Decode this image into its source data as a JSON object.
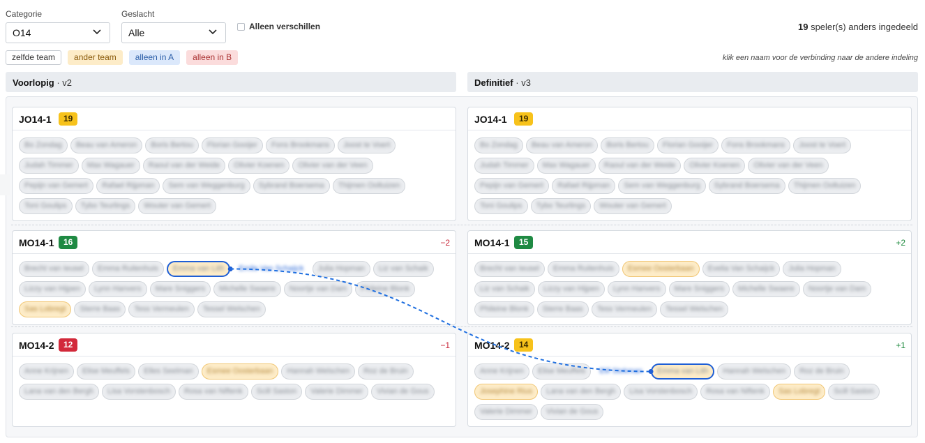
{
  "filters": {
    "category": {
      "label": "Categorie",
      "value": "O14"
    },
    "gender": {
      "label": "Geslacht",
      "value": "Alle"
    },
    "only_diff": {
      "label": "Alleen verschillen"
    }
  },
  "summary": {
    "count": "19",
    "text": "speler(s) anders ingedeeld"
  },
  "legend": {
    "same": "zelfde team",
    "other": "ander team",
    "only_a": "alleen in A",
    "only_b": "alleen in B"
  },
  "hint": "klik een naam voor de verbinding naar de andere indeling",
  "columns": {
    "left": {
      "name": "Voorlopig",
      "version": "· v2"
    },
    "right": {
      "name": "Definitief",
      "version": "· v3"
    }
  },
  "colors": {
    "accent": "#1f5fd6",
    "changed": "#fdecc8",
    "only_a": "#dbe8fb",
    "only_b": "#fbdcdc"
  },
  "left_teams": [
    {
      "name": "JO14-1",
      "count": "19",
      "badge": "yellow",
      "delta": "",
      "players": [
        {
          "n": "Bo Zondag",
          "s": ""
        },
        {
          "n": "Beau van Ameron",
          "s": ""
        },
        {
          "n": "Boris Bertou",
          "s": ""
        },
        {
          "n": "Florian Gooijer",
          "s": ""
        },
        {
          "n": "Fons Brookmans",
          "s": ""
        },
        {
          "n": "Joost te Voert",
          "s": ""
        },
        {
          "n": "Judah Timmer",
          "s": ""
        },
        {
          "n": "Max Wagauer",
          "s": ""
        },
        {
          "n": "Raoul van der Weide",
          "s": ""
        },
        {
          "n": "Olivier Koenen",
          "s": ""
        },
        {
          "n": "Olivier van der Veen",
          "s": ""
        },
        {
          "n": "Pepijn van Gemert",
          "s": ""
        },
        {
          "n": "Rafael Rijpman",
          "s": ""
        },
        {
          "n": "Sem van Weggenburg",
          "s": ""
        },
        {
          "n": "Sybrand Boersema",
          "s": ""
        },
        {
          "n": "Thijmen Ooltuizen",
          "s": ""
        },
        {
          "n": "Toni Goulips",
          "s": ""
        },
        {
          "n": "Tybo Teurlings",
          "s": ""
        },
        {
          "n": "Wouter van Gemert",
          "s": ""
        }
      ]
    },
    {
      "name": "MO14-1",
      "count": "16",
      "badge": "green",
      "delta": "−2",
      "players": [
        {
          "n": "Brecht van Ieusel",
          "s": ""
        },
        {
          "n": "Emma Ruitenhuis",
          "s": ""
        },
        {
          "n": "Emma van Lith",
          "s": "sel"
        },
        {
          "n": "Emile Van Schaijck",
          "s": "blue"
        },
        {
          "n": "Julia Hopman",
          "s": ""
        },
        {
          "n": "Liz van Schaik",
          "s": ""
        },
        {
          "n": "Lizzy van Hijpen",
          "s": ""
        },
        {
          "n": "Lynn Hanvers",
          "s": ""
        },
        {
          "n": "Mare Sniggers",
          "s": ""
        },
        {
          "n": "Michelle Swaere",
          "s": ""
        },
        {
          "n": "Noortje van Dam",
          "s": ""
        },
        {
          "n": "Phileine Blonk",
          "s": ""
        },
        {
          "n": "Sas Lobregt",
          "s": "orange"
        },
        {
          "n": "Sterre Baas",
          "s": ""
        },
        {
          "n": "Tess Vermeulen",
          "s": ""
        },
        {
          "n": "Tessel Welschen",
          "s": ""
        }
      ]
    },
    {
      "name": "MO14-2",
      "count": "12",
      "badge": "red",
      "delta": "−1",
      "players": [
        {
          "n": "Anne Krijnen",
          "s": ""
        },
        {
          "n": "Elise Meuffels",
          "s": ""
        },
        {
          "n": "Elles Seelman",
          "s": ""
        },
        {
          "n": "Esmee Oosterbaan",
          "s": "orange"
        },
        {
          "n": "Hannah Welschen",
          "s": ""
        },
        {
          "n": "Roz de Bruin",
          "s": ""
        },
        {
          "n": "Lana van den Bergh",
          "s": ""
        },
        {
          "n": "Lisa Vorstenbosch",
          "s": ""
        },
        {
          "n": "Rosa van Niftenk",
          "s": ""
        },
        {
          "n": "Scill Saston",
          "s": ""
        },
        {
          "n": "Valerie Dimmer",
          "s": ""
        },
        {
          "n": "Vivian de Gous",
          "s": ""
        }
      ]
    }
  ],
  "right_teams": [
    {
      "name": "JO14-1",
      "count": "19",
      "badge": "yellow",
      "delta": "",
      "players": [
        {
          "n": "Bo Zondag",
          "s": ""
        },
        {
          "n": "Beau van Ameron",
          "s": ""
        },
        {
          "n": "Boris Bertou",
          "s": ""
        },
        {
          "n": "Florian Gooijer",
          "s": ""
        },
        {
          "n": "Fons Brookmans",
          "s": ""
        },
        {
          "n": "Joost te Voert",
          "s": ""
        },
        {
          "n": "Judah Timmer",
          "s": ""
        },
        {
          "n": "Max Wagauer",
          "s": ""
        },
        {
          "n": "Raoul van der Weide",
          "s": ""
        },
        {
          "n": "Olivier Koenen",
          "s": ""
        },
        {
          "n": "Olivier van der Veen",
          "s": ""
        },
        {
          "n": "Pepijn van Gemert",
          "s": ""
        },
        {
          "n": "Rafael Rijpman",
          "s": ""
        },
        {
          "n": "Sem van Weggenburg",
          "s": ""
        },
        {
          "n": "Sybrand Boersema",
          "s": ""
        },
        {
          "n": "Thijmen Ooltuizen",
          "s": ""
        },
        {
          "n": "Toni Goulips",
          "s": ""
        },
        {
          "n": "Tybo Teurlings",
          "s": ""
        },
        {
          "n": "Wouter van Gemert",
          "s": ""
        }
      ]
    },
    {
      "name": "MO14-1",
      "count": "15",
      "badge": "green",
      "delta": "+2",
      "players": [
        {
          "n": "Brecht van Ieusel",
          "s": ""
        },
        {
          "n": "Emma Ruitenhuis",
          "s": ""
        },
        {
          "n": "Esmee Oosterbaan",
          "s": "orange"
        },
        {
          "n": "Evelia Van Schaijck",
          "s": ""
        },
        {
          "n": "Julia Hopman",
          "s": ""
        },
        {
          "n": "Liz van Schaik",
          "s": ""
        },
        {
          "n": "Lizzy van Hijpen",
          "s": ""
        },
        {
          "n": "Lynn Hanvers",
          "s": ""
        },
        {
          "n": "Mare Sniggers",
          "s": ""
        },
        {
          "n": "Michelle Swaere",
          "s": ""
        },
        {
          "n": "Noortje van Dam",
          "s": ""
        },
        {
          "n": "Phileine Blonk",
          "s": ""
        },
        {
          "n": "Sterre Baas",
          "s": ""
        },
        {
          "n": "Tess Vermeulen",
          "s": ""
        },
        {
          "n": "Tessel Welschen",
          "s": ""
        }
      ]
    },
    {
      "name": "MO14-2",
      "count": "14",
      "badge": "yellow",
      "delta": "+1",
      "players": [
        {
          "n": "Anne Krijnen",
          "s": ""
        },
        {
          "n": "Elise Meuffels",
          "s": ""
        },
        {
          "n": "Elif Stokman",
          "s": "blue"
        },
        {
          "n": "Emma van Lith",
          "s": "sel"
        },
        {
          "n": "Hannah Welschen",
          "s": ""
        },
        {
          "n": "Roz de Bruin",
          "s": ""
        },
        {
          "n": "Josephine Rius",
          "s": "orange"
        },
        {
          "n": "Lana van den Bergh",
          "s": ""
        },
        {
          "n": "Lisa Vorstenbosch",
          "s": ""
        },
        {
          "n": "Rosa van Niftenk",
          "s": ""
        },
        {
          "n": "Sas Lobregt",
          "s": "orange"
        },
        {
          "n": "Scill Saston",
          "s": ""
        },
        {
          "n": "Valerie Dimmer",
          "s": ""
        },
        {
          "n": "Vivian de Gous",
          "s": ""
        }
      ]
    }
  ]
}
